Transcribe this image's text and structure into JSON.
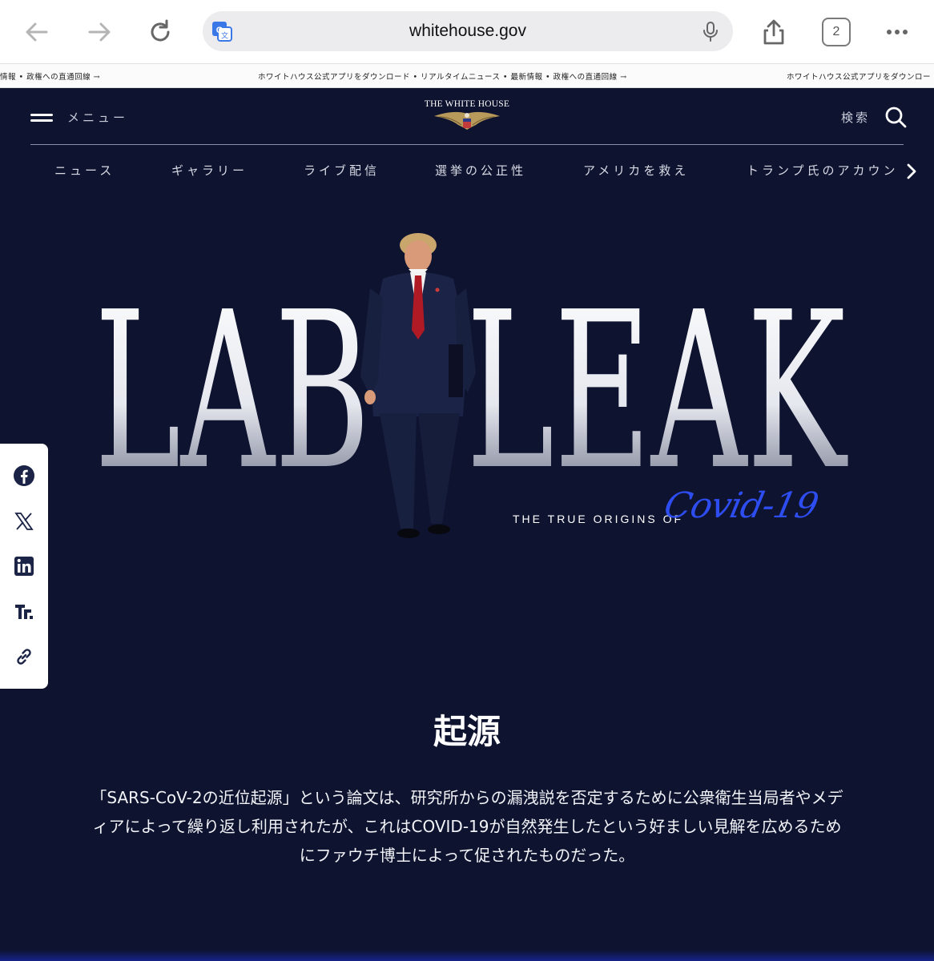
{
  "browser": {
    "url": "whitehouse.gov",
    "tab_count": "2"
  },
  "ticker": {
    "text_left": "情報 • 政権への直通回線 →",
    "text_center": "ホワイトハウス公式アプリをダウンロード • リアルタイムニュース • 最新情報 • 政権への直通回線 →",
    "text_right": "ホワイトハウス公式アプリをダウンロー"
  },
  "header": {
    "menu_label": "メニュー",
    "logo_text": "THE WHITE HOUSE",
    "search_label": "検索"
  },
  "nav": {
    "items": [
      "ニュース",
      "ギャラリー",
      "ライブ配信",
      "選挙の公正性",
      "アメリカを救え",
      "トランプ氏のアカウン"
    ]
  },
  "hero": {
    "title_left": "LAB",
    "title_right": "LEAK",
    "subtitle": "THE TRUE ORIGINS OF",
    "script": "Covid-19"
  },
  "share": {
    "icons": [
      "facebook-icon",
      "x-icon",
      "linkedin-icon",
      "truth-social-icon",
      "link-icon"
    ]
  },
  "section": {
    "title": "起源",
    "body": "「SARS-CoV-2の近位起源」という論文は、研究所からの漏洩説を否定するために公衆衛生当局者やメディアによって繰り返し利用されたが、これはCOVID-19が自然発生したという好ましい見解を広めるためにファウチ博士によって促されたものだった。"
  },
  "colors": {
    "background": "#0e1330",
    "accent_script": "#2d4df0",
    "tie": "#b01a25"
  }
}
